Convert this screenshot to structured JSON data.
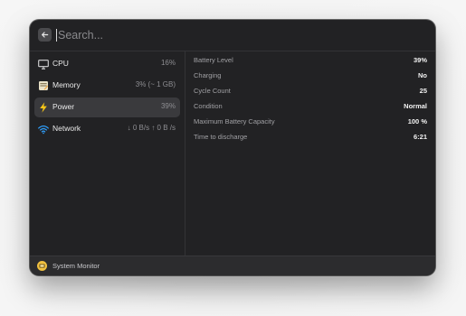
{
  "search": {
    "placeholder": "Search..."
  },
  "items": [
    {
      "label": "CPU",
      "value": "16%",
      "icon": "monitor-icon",
      "selected": false
    },
    {
      "label": "Memory",
      "value": "3% (~ 1 GB)",
      "icon": "memory-icon",
      "selected": false
    },
    {
      "label": "Power",
      "value": "39%",
      "icon": "lightning-icon",
      "selected": true
    },
    {
      "label": "Network",
      "value": "↓ 0 B/s ↑ 0 B /s",
      "icon": "wifi-icon",
      "selected": false
    }
  ],
  "details": [
    {
      "label": "Battery Level",
      "value": "39%"
    },
    {
      "label": "Charging",
      "value": "No"
    },
    {
      "label": "Cycle Count",
      "value": "25"
    },
    {
      "label": "Condition",
      "value": "Normal"
    },
    {
      "label": "Maximum Battery Capacity",
      "value": "100 %"
    },
    {
      "label": "Time to discharge",
      "value": "6:21"
    }
  ],
  "footer": {
    "title": "System Monitor",
    "icon": "system-monitor-icon"
  },
  "colors": {
    "window_bg": "#222224",
    "selected_bg": "#3a3a3d",
    "power_accent": "#f5c518",
    "wifi_accent": "#2f9bf5"
  }
}
